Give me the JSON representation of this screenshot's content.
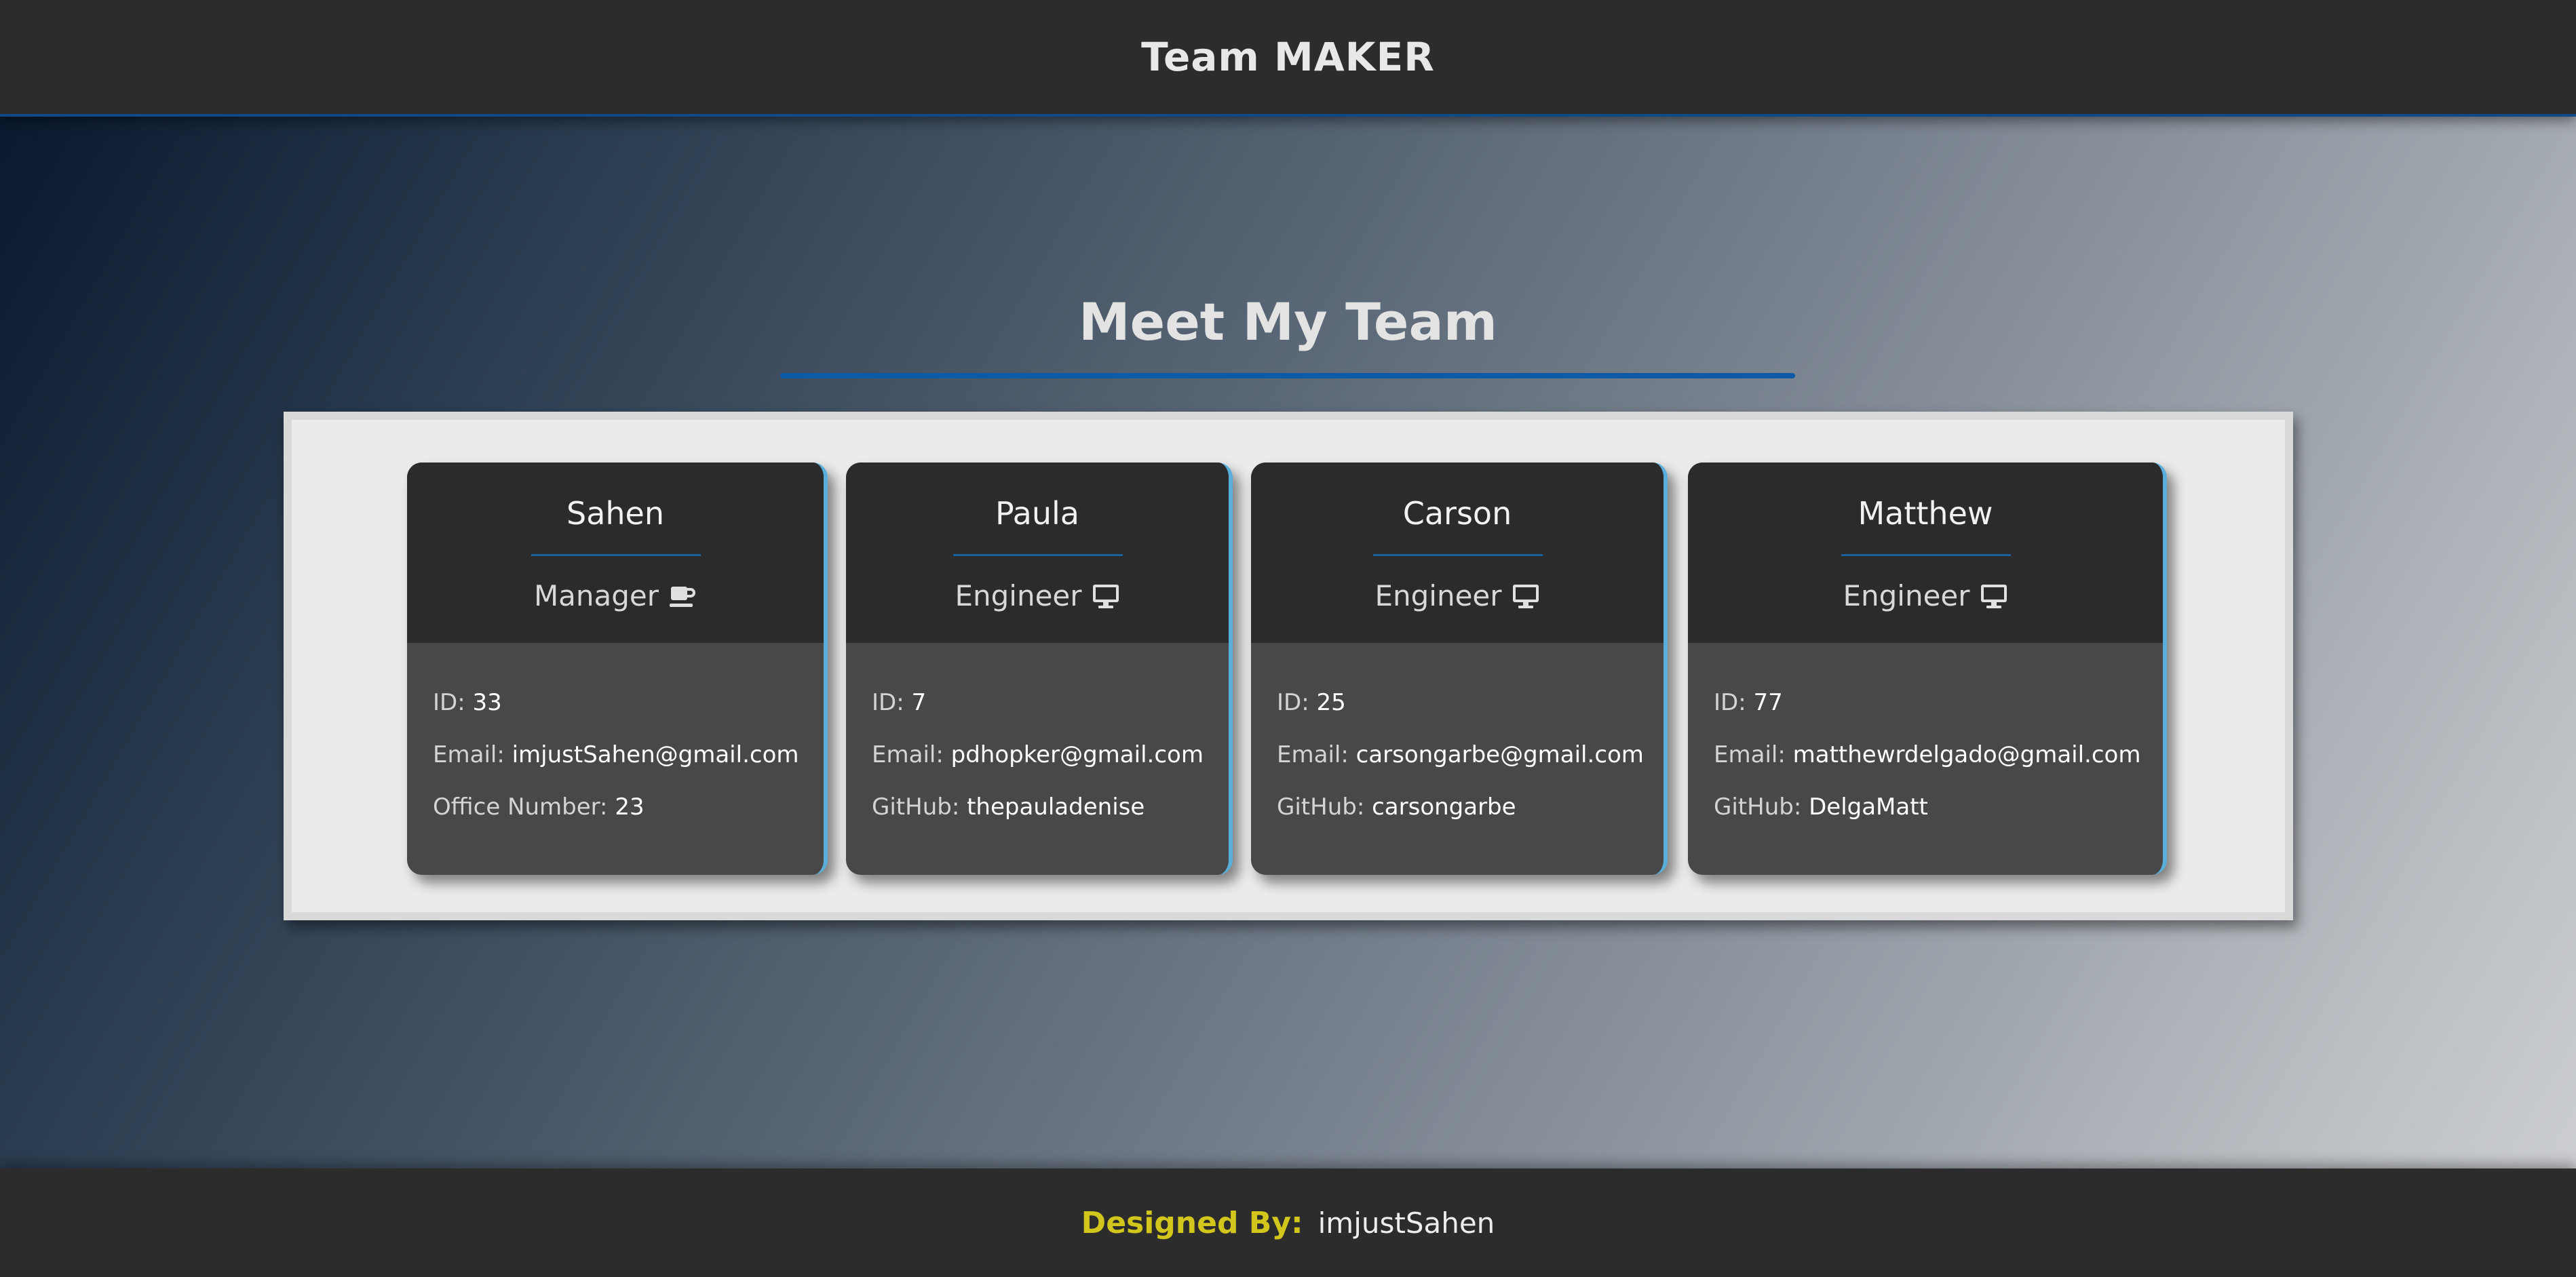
{
  "header": {
    "title": "Team MAKER"
  },
  "section": {
    "title": "Meet My Team"
  },
  "cards": [
    {
      "name": "Sahen",
      "role": "Manager",
      "icon": "coffee-icon",
      "fields": [
        {
          "label": "ID:",
          "value": "33"
        },
        {
          "label": "Email:",
          "value": "imjustSahen@gmail.com"
        },
        {
          "label": "Office Number:",
          "value": "23"
        }
      ]
    },
    {
      "name": "Paula",
      "role": "Engineer",
      "icon": "monitor-icon",
      "fields": [
        {
          "label": "ID:",
          "value": "7"
        },
        {
          "label": "Email:",
          "value": "pdhopker@gmail.com"
        },
        {
          "label": "GitHub:",
          "value": "thepauladenise"
        }
      ]
    },
    {
      "name": "Carson",
      "role": "Engineer",
      "icon": "monitor-icon",
      "fields": [
        {
          "label": "ID:",
          "value": "25"
        },
        {
          "label": "Email:",
          "value": "carsongarbe@gmail.com"
        },
        {
          "label": "GitHub:",
          "value": "carsongarbe"
        }
      ]
    },
    {
      "name": "Matthew",
      "role": "Engineer",
      "icon": "monitor-icon",
      "fields": [
        {
          "label": "ID:",
          "value": "77"
        },
        {
          "label": "Email:",
          "value": "matthewrdelgado@gmail.com"
        },
        {
          "label": "GitHub:",
          "value": "DelgaMatt"
        }
      ]
    }
  ],
  "footer": {
    "label": "Designed By:",
    "name": "imjustSahen"
  },
  "colors": {
    "accent_blue": "#0f5aa6",
    "card_edge": "#5aaeda",
    "footer_label": "#d2c51c",
    "dark_bar": "#2c2c2c"
  }
}
